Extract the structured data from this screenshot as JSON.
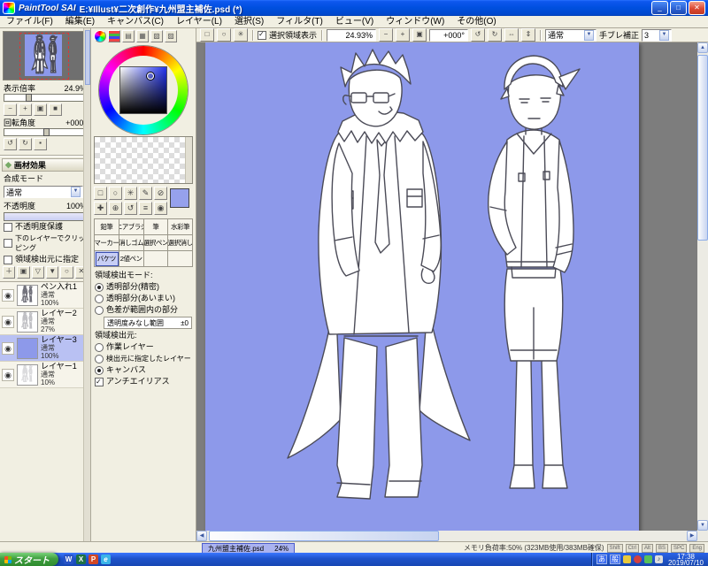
{
  "window": {
    "logo": "PaintTool SAI",
    "title": "E:¥Illust¥二次創作¥九州盟主補佐.psd (*)"
  },
  "menu": {
    "items": [
      "ファイル(F)",
      "編集(E)",
      "キャンバス(C)",
      "レイヤー(L)",
      "選択(S)",
      "フィルタ(T)",
      "ビュー(V)",
      "ウィンドウ(W)",
      "その他(O)"
    ]
  },
  "toolbar": {
    "show_selection": "選択領域表示",
    "zoom": "24.93%",
    "angle": "+000°",
    "mode": "通常",
    "stabilizer": "手ブレ補正",
    "stabilizer_value": "3"
  },
  "navigator": {
    "zoom_label": "表示倍率",
    "zoom": "24.9%",
    "angle_label": "回転角度",
    "angle": "+000°"
  },
  "material": {
    "header": "画材効果",
    "blend_label": "合成モード",
    "blend": "通常",
    "opacity_label": "不透明度",
    "opacity": "100%",
    "checks": [
      "不透明度保護",
      "下のレイヤーでクリッピング",
      "領域検出元に指定"
    ]
  },
  "layers": [
    {
      "name": "ペン入れ1",
      "mode": "通常",
      "opacity": "100%"
    },
    {
      "name": "レイヤー2",
      "mode": "通常",
      "opacity": "27%"
    },
    {
      "name": "レイヤー3",
      "mode": "通常",
      "opacity": "100%"
    },
    {
      "name": "レイヤー1",
      "mode": "通常",
      "opacity": "10%"
    }
  ],
  "tools": {
    "grid": [
      "鉛筆",
      "エアブラシ",
      "筆",
      "水彩筆",
      "マーカー",
      "消しゴム",
      "選択ペン",
      "選択消し",
      "バケツ",
      "2値ペン"
    ]
  },
  "options": {
    "detect_header": "領域検出モード:",
    "modes": [
      "透明部分(精密)",
      "透明部分(あいまい)",
      "色差が範囲内の部分"
    ],
    "tolerance_label": "透明度みなし範囲",
    "tolerance": "±0",
    "source_header": "領域検出元:",
    "sources": [
      "作業レイヤー",
      "検出元に指定したレイヤー",
      "キャンバス"
    ],
    "antialias": "アンチエイリアス"
  },
  "status": {
    "doc": "九州盟主補佐.psd",
    "zoom": "24%",
    "memory": "メモリ負荷率:50% (323MB使用/383MB確保)",
    "keys": [
      "Shift",
      "Ctrl",
      "Alt",
      "BS",
      "SPC",
      "Eng"
    ]
  },
  "taskbar": {
    "start": "スタート",
    "quicklaunch": [
      "W",
      "X",
      "P",
      "e"
    ],
    "ime": [
      "あ",
      "般"
    ],
    "time": "17:38",
    "date": "2019/07/10"
  },
  "colors": {
    "canvas_bg": "#8d99ea",
    "current_color": "#96a1ec",
    "selected_layer": "#b9c1f3"
  }
}
